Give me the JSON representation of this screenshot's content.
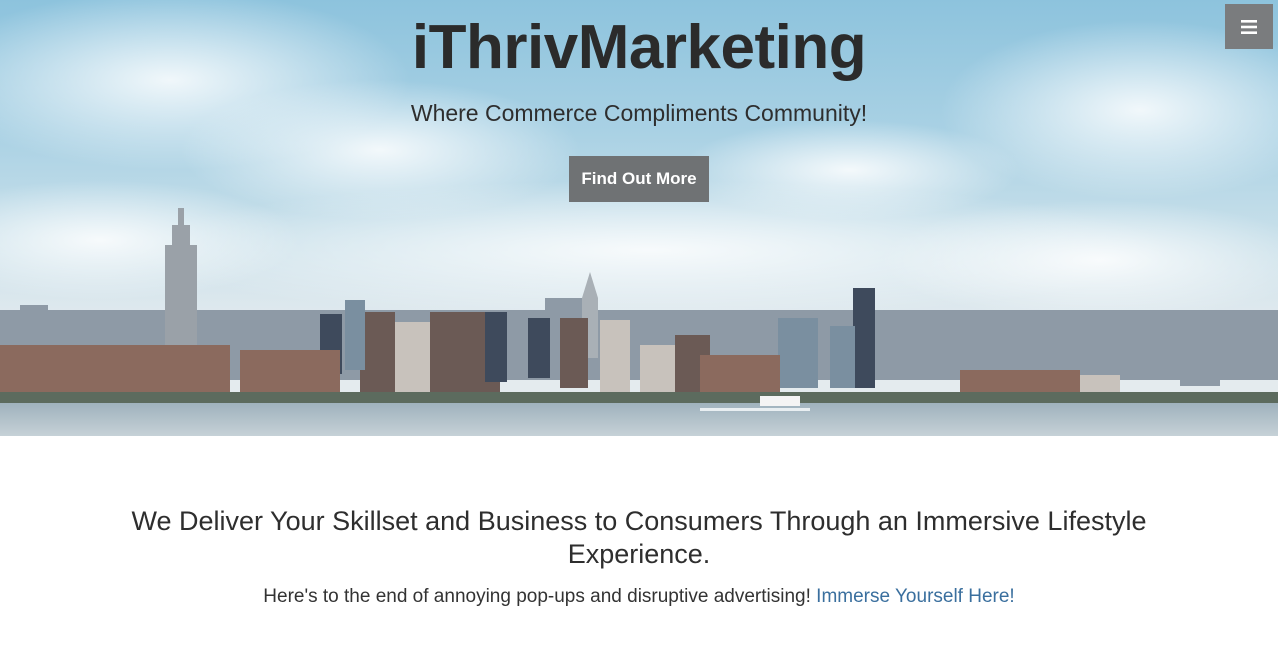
{
  "hero": {
    "brand": "iThrivMarketing",
    "tagline": "Where Commerce Compliments Community!",
    "cta_label": "Find Out More",
    "menu_icon": "hamburger-menu-icon"
  },
  "intro": {
    "headline": "We Deliver Your Skillset and Business to Consumers Through an Immersive Lifestyle Experience.",
    "subline_text": "Here's to the end of annoying pop-ups and disruptive advertising!",
    "subline_link": "Immerse Yourself Here!"
  },
  "colors": {
    "cta_background": "#6f7274",
    "link": "#3a6f9e",
    "menu_button": "#7a7c7e"
  }
}
